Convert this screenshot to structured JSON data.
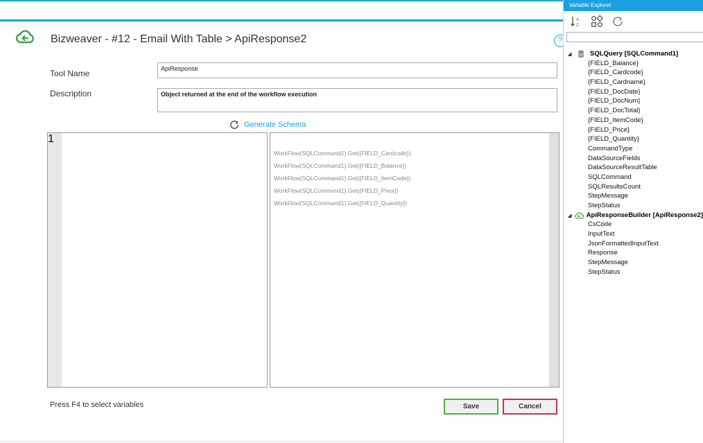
{
  "header": {
    "title": "Bizweaver - #12 - Email With Table > ApiResponse2",
    "help_label": "?"
  },
  "form": {
    "tool_name_label": "Tool Name",
    "tool_name_value": "ApiResponse",
    "description_label": "Description",
    "description_value": "Object returned at the end of the workflow execution",
    "generate_schema_label": "Generate Schema"
  },
  "editor": {
    "line_number": "1"
  },
  "variables": [
    "WorkFlow(SQLCommand1).Get({FIELD_Cardcode})",
    "WorkFlow(SQLCommand1).Get({FIELD_Balance})",
    "WorkFlow(SQLCommand1).Get({FIELD_ItemCode})",
    "WorkFlow(SQLCommand1).Get({FIELD_Price})",
    "WorkFlow(SQLCommand1).Get({FIELD_Quantity})"
  ],
  "footer": {
    "hint": "Press F4 to select variables",
    "save_label": "Save",
    "cancel_label": "Cancel"
  },
  "variable_explorer": {
    "title": "Variable Explorer",
    "groups": [
      {
        "label": "SQLQuery [SQLCommand1]",
        "icon": "database-icon",
        "items": [
          "{FIELD_Balance}",
          "{FIELD_Cardcode}",
          "{FIELD_Cardname}",
          "{FIELD_DocDate}",
          "{FIELD_DocNum}",
          "{FIELD_DocTotal}",
          "{FIELD_ItemCode}",
          "{FIELD_Price}",
          "{FIELD_Quantity}",
          "CommandType",
          "DataSourceFields",
          "DataSourceResultTable",
          "SQLCommand",
          "SQLResultsCount",
          "StepMessage",
          "StepStatus"
        ]
      },
      {
        "label": "ApiResponseBuilder [ApiResponse2]",
        "icon": "cloud-icon",
        "items": [
          "CsCode",
          "InputText",
          "JsonFormattedInputText",
          "Response",
          "StepMessage",
          "StepStatus"
        ]
      }
    ]
  },
  "colors": {
    "accent": "#1ba1e2",
    "save_border": "#4caf50",
    "cancel_border": "#c8324b",
    "cloud_icon": "#3aa54a"
  }
}
